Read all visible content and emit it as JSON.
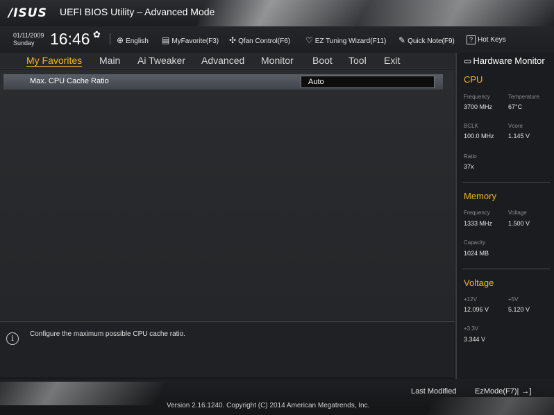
{
  "titlebar": {
    "logo": "/ISUS",
    "title": "UEFI BIOS Utility – Advanced Mode"
  },
  "toolbar": {
    "date": "01/11/2009",
    "day": "Sunday",
    "time": "16:46",
    "items": [
      {
        "icon": "globe-icon",
        "label": "English"
      },
      {
        "icon": "favorite-icon",
        "label": "MyFavorite(F3)"
      },
      {
        "icon": "fan-icon",
        "label": "Qfan Control(F6)"
      },
      {
        "icon": "lightbulb-icon",
        "label": "EZ Tuning Wizard(F11)"
      },
      {
        "icon": "note-icon",
        "label": "Quick Note(F9)"
      },
      {
        "icon": "hotkey-icon",
        "box": "?",
        "label": "Hot Keys"
      }
    ]
  },
  "menu": [
    {
      "label": "My Favorites",
      "active": true
    },
    {
      "label": "Main"
    },
    {
      "label": "Ai Tweaker"
    },
    {
      "label": "Advanced"
    },
    {
      "label": "Monitor"
    },
    {
      "label": "Boot"
    },
    {
      "label": "Tool"
    },
    {
      "label": "Exit"
    }
  ],
  "settings": [
    {
      "label": "Max. CPU Cache Ratio",
      "value": "Auto"
    }
  ],
  "help": {
    "text": "Configure the maximum possible CPU cache ratio."
  },
  "hardware_monitor": {
    "title": "Hardware Monitor",
    "cpu": {
      "title": "CPU",
      "frequency_label": "Frequency",
      "frequency": "3700 MHz",
      "temperature_label": "Temperature",
      "temperature": "67°C",
      "bclk_label": "BCLK",
      "bclk": "100.0 MHz",
      "vcore_label": "Vcore",
      "vcore": "1.145 V",
      "ratio_label": "Ratio",
      "ratio": "37x"
    },
    "memory": {
      "title": "Memory",
      "frequency_label": "Frequency",
      "frequency": "1333 MHz",
      "voltage_label": "Voltage",
      "voltage": "1.500 V",
      "capacity_label": "Capacity",
      "capacity": "1024 MB"
    },
    "voltage": {
      "title": "Voltage",
      "v12_label": "+12V",
      "v12": "12.096 V",
      "v5_label": "+5V",
      "v5": "5.120 V",
      "v33_label": "+3.3V",
      "v33": "3.344 V"
    }
  },
  "footer": {
    "last_modified": "Last Modified",
    "ezmode": "EzMode(F7)|",
    "version": "Version 2.16.1240. Copyright (C) 2014 American Megatrends, Inc."
  },
  "colors": {
    "accent": "#f2b61d",
    "row_highlight": "#4f535a"
  }
}
